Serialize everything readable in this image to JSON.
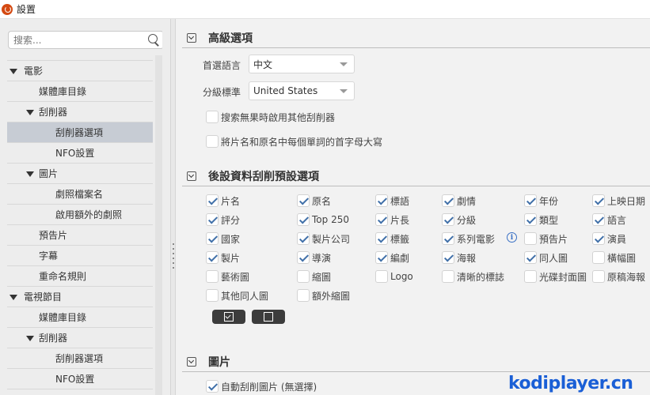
{
  "window": {
    "title": "設置"
  },
  "search": {
    "placeholder": "搜索..."
  },
  "sidebar": {
    "items": [
      {
        "label": "電影"
      },
      {
        "label": "媒體庫目錄"
      },
      {
        "label": "刮削器"
      },
      {
        "label": "刮削器選項"
      },
      {
        "label": "NFO設置"
      },
      {
        "label": "圖片"
      },
      {
        "label": "劇照檔案名"
      },
      {
        "label": "啟用額外的劇照"
      },
      {
        "label": "預告片"
      },
      {
        "label": "字幕"
      },
      {
        "label": "重命名規則"
      },
      {
        "label": "電視節目"
      },
      {
        "label": "媒體庫目錄"
      },
      {
        "label": "刮削器"
      },
      {
        "label": "刮削器選項"
      },
      {
        "label": "NFO設置"
      }
    ]
  },
  "advanced": {
    "title": "高級選項",
    "language_label": "首選語言",
    "language_value": "中文",
    "rating_label": "分級標準",
    "rating_value": "United States",
    "opt1": "搜索無果時啟用其他刮削器",
    "opt2": "將片名和原名中每個單詞的首字母大寫"
  },
  "scrape_defaults": {
    "title": "後設資料刮削預設選項",
    "items": [
      {
        "label": "片名",
        "checked": true
      },
      {
        "label": "原名",
        "checked": true
      },
      {
        "label": "標語",
        "checked": true
      },
      {
        "label": "劇情",
        "checked": true
      },
      {
        "label": "年份",
        "checked": true
      },
      {
        "label": "上映日期",
        "checked": true
      },
      {
        "label": "評分",
        "checked": true
      },
      {
        "label": "Top 250",
        "checked": true
      },
      {
        "label": "片長",
        "checked": true
      },
      {
        "label": "分級",
        "checked": true
      },
      {
        "label": "類型",
        "checked": true
      },
      {
        "label": "語言",
        "checked": true
      },
      {
        "label": "國家",
        "checked": true
      },
      {
        "label": "製片公司",
        "checked": true
      },
      {
        "label": "標籤",
        "checked": true
      },
      {
        "label": "系列電影",
        "checked": true
      },
      {
        "label": "預告片",
        "checked": false
      },
      {
        "label": "演員",
        "checked": true
      },
      {
        "label": "製片",
        "checked": true
      },
      {
        "label": "導演",
        "checked": true
      },
      {
        "label": "編劇",
        "checked": true
      },
      {
        "label": "海報",
        "checked": true
      },
      {
        "label": "同人圖",
        "checked": true
      },
      {
        "label": "橫幅圖",
        "checked": false
      },
      {
        "label": "藝術圖",
        "checked": false
      },
      {
        "label": "縮圖",
        "checked": false
      },
      {
        "label": "Logo",
        "checked": false
      },
      {
        "label": "清晰的標誌",
        "checked": false
      },
      {
        "label": "光碟封面圖",
        "checked": false
      },
      {
        "label": "原稿海報",
        "checked": false
      },
      {
        "label": "其他同人圖",
        "checked": false
      },
      {
        "label": "額外縮圖",
        "checked": false
      }
    ],
    "info_icon": "info-icon"
  },
  "images": {
    "title": "圖片",
    "auto_scrape": "自動刮削圖片 (無選擇)",
    "auto_scrape_checked": true
  },
  "watermark": {
    "text": "kodiplayer.cn"
  },
  "colors": {
    "accent": "#3f6fa8",
    "selected": "#c7ccd4",
    "watermark": "#1a5fd6"
  }
}
